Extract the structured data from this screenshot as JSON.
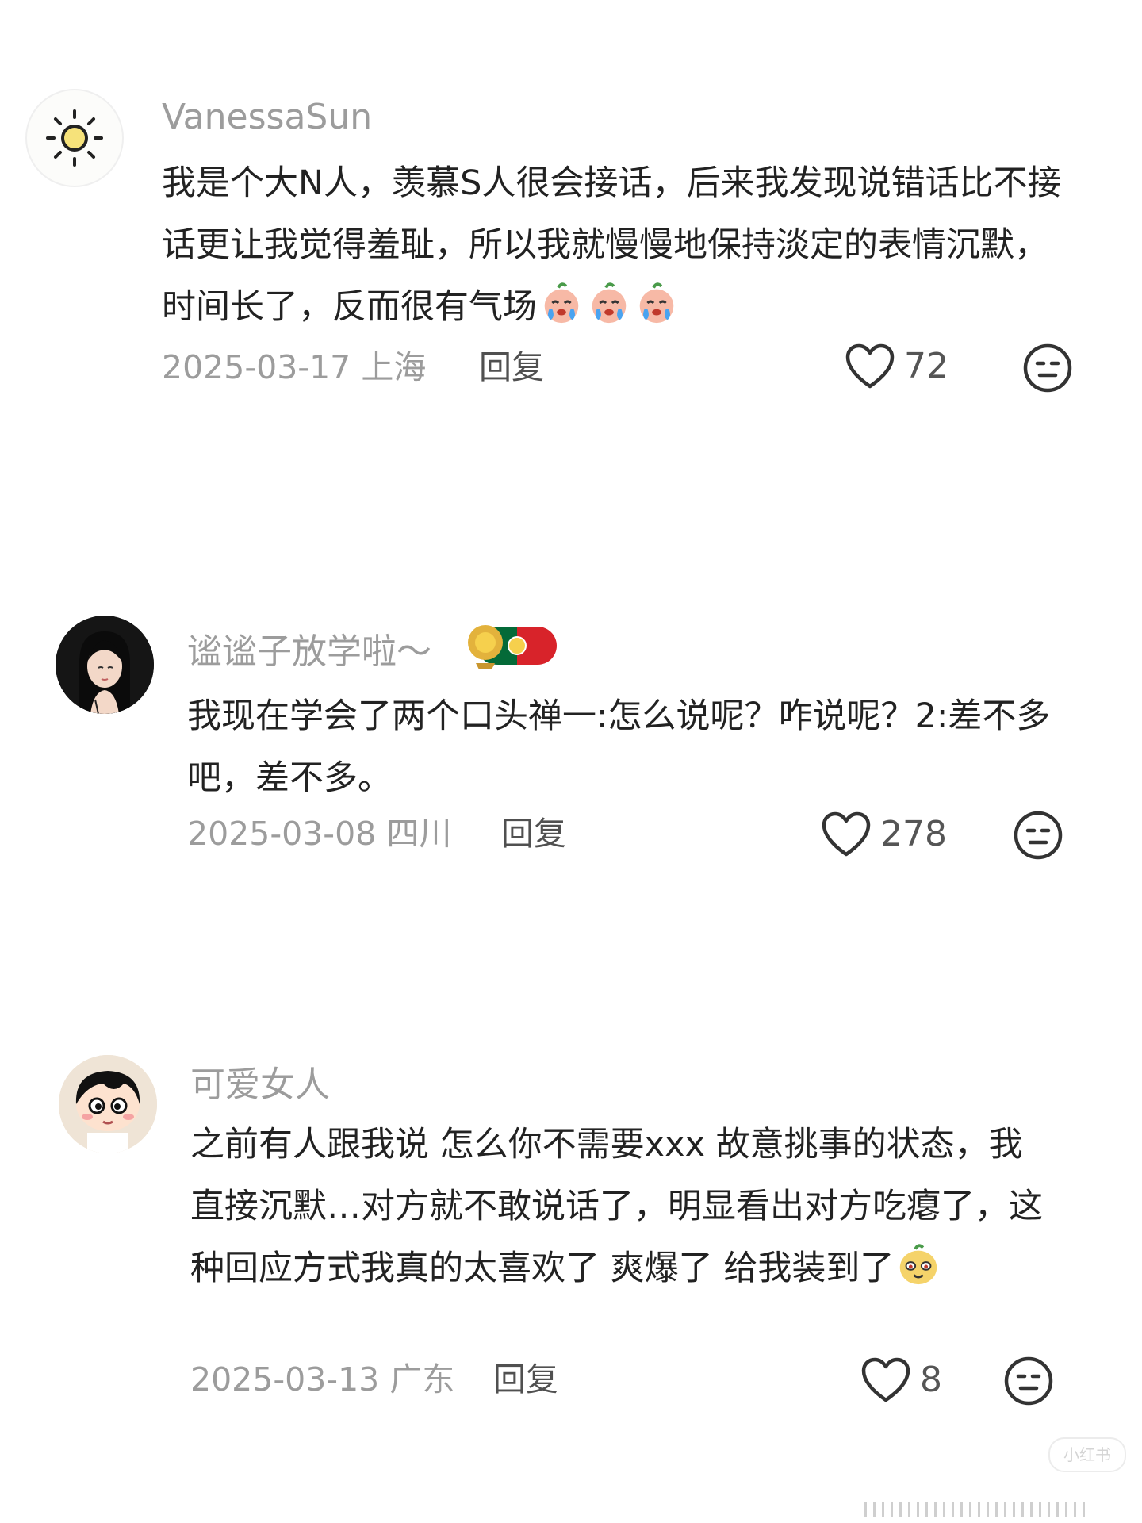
{
  "comments": [
    {
      "username": "VanessaSun",
      "text": "我是个大N人，羡慕S人很会接话，后来我发现说错话比不接话更让我觉得羞耻，所以我就慢慢地保持淡定的表情沉默，时间长了，反而很有气场",
      "date": "2025-03-17",
      "location": "上海",
      "reply_label": "回复",
      "likes": "72",
      "avatar_icon": "sun-icon",
      "emoji": "crying-peach-emoji"
    },
    {
      "username": "谧谧子放学啦～",
      "text": "我现在学会了两个口头禅一:怎么说呢？咋说呢？2:差不多吧，差不多。",
      "date": "2025-03-08",
      "location": "四川",
      "reply_label": "回复",
      "likes": "278",
      "badge_icon": "portugal-flag-badge-icon"
    },
    {
      "username": "可爱女人",
      "text": "之前有人跟我说 怎么你不需要xxx 故意挑事的状态，我直接沉默…对方就不敢说话了，明显看出对方吃瘪了，这种回应方式我真的太喜欢了 爽爆了 给我装到了",
      "date": "2025-03-13",
      "location": "广东",
      "reply_label": "回复",
      "likes": "8",
      "emoji": "smug-face-emoji"
    }
  ],
  "watermark": "小红书",
  "colors": {
    "username": "#9c9c9c",
    "text": "#222222",
    "meta": "#9c9c9c",
    "reply": "#505050"
  }
}
